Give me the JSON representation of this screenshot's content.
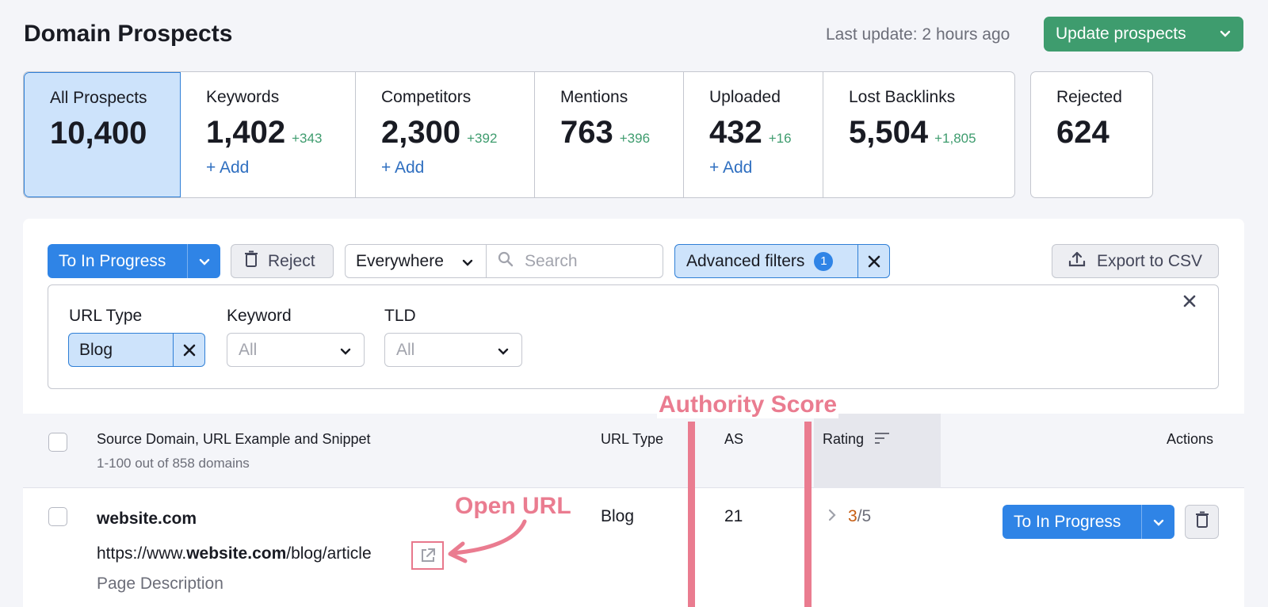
{
  "header": {
    "title": "Domain Prospects",
    "last_update": "Last update: 2 hours ago",
    "update_button": "Update prospects"
  },
  "tabs": [
    {
      "label": "All Prospects",
      "count": "10,400",
      "delta": "",
      "add": ""
    },
    {
      "label": "Keywords",
      "count": "1,402",
      "delta": "+343",
      "add": "+ Add"
    },
    {
      "label": "Competitors",
      "count": "2,300",
      "delta": "+392",
      "add": "+ Add"
    },
    {
      "label": "Mentions",
      "count": "763",
      "delta": "+396",
      "add": ""
    },
    {
      "label": "Uploaded",
      "count": "432",
      "delta": "+16",
      "add": "+ Add"
    },
    {
      "label": "Lost Backlinks",
      "count": "5,504",
      "delta": "+1,805",
      "add": ""
    }
  ],
  "rejected_tab": {
    "label": "Rejected",
    "count": "624"
  },
  "toolbar": {
    "to_in_progress": "To In Progress",
    "reject": "Reject",
    "scope": "Everywhere",
    "search_placeholder": "Search",
    "advanced_filters": "Advanced filters",
    "advanced_filters_count": "1",
    "export": "Export to CSV"
  },
  "filters": {
    "url_type": {
      "label": "URL Type",
      "value": "Blog"
    },
    "keyword": {
      "label": "Keyword",
      "value": "All"
    },
    "tld": {
      "label": "TLD",
      "value": "All"
    }
  },
  "table": {
    "headers": {
      "source": "Source Domain, URL Example and Snippet",
      "source_sub": "1-100 out of 858 domains",
      "url_type": "URL Type",
      "as": "AS",
      "rating": "Rating",
      "actions": "Actions"
    },
    "rows": [
      {
        "domain": "website.com",
        "url_prefix": "https://www.",
        "url_bold": "website.com",
        "url_suffix": "/blog/article",
        "description": "Page Description",
        "url_type": "Blog",
        "as": "21",
        "rating_score": "3",
        "rating_total": "/5",
        "action": "To In Progress"
      }
    ]
  },
  "annotations": {
    "authority_score": "Authority Score",
    "open_url": "Open URL"
  },
  "colors": {
    "accent_blue": "#2f84e6",
    "update_green": "#3e9c6e",
    "annotation_pink": "#ea7c90",
    "active_tab_bg": "#cde3fb"
  }
}
